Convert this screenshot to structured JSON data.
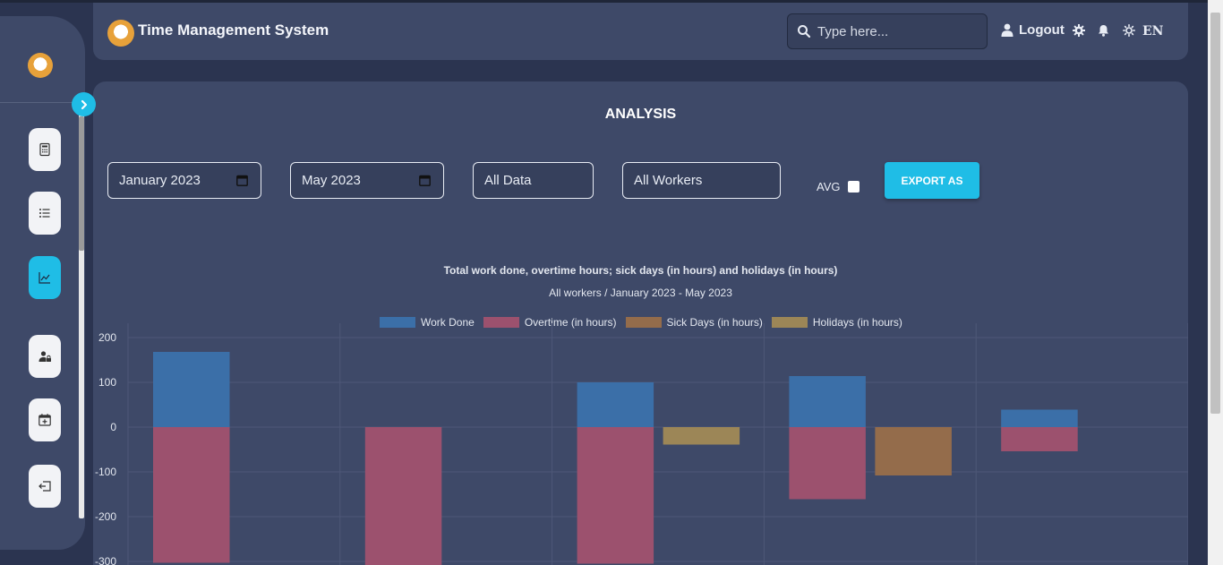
{
  "app": {
    "title": "Time Management System",
    "search_placeholder": "Type here...",
    "logout_label": "Logout",
    "language": "EN"
  },
  "sidebar": {
    "items": [
      {
        "icon": "calculator-icon",
        "active": false
      },
      {
        "icon": "list-icon",
        "active": false
      },
      {
        "icon": "chart-line-icon",
        "active": true
      },
      {
        "icon": "user-lock-icon",
        "active": false
      },
      {
        "icon": "calendar-plus-icon",
        "active": false
      },
      {
        "icon": "logout-icon",
        "active": false
      }
    ]
  },
  "colors": {
    "accent": "#1fbde6",
    "work_done": "#3b6fa8",
    "overtime": "#9c516e",
    "sick_days": "#946c4b",
    "holidays": "#9c8657"
  },
  "analysis": {
    "title": "ANALYSIS",
    "start_month": "January 2023",
    "end_month": "May 2023",
    "data_filter": "All Data",
    "worker_filter": "All Workers",
    "avg_label": "AVG",
    "avg_checked": false,
    "export_label": "EXPORT AS"
  },
  "chart_data": {
    "type": "bar",
    "title": "Total work done, overtime hours; sick days (in hours) and holidays (in hours)",
    "subtitle": "All workers / January 2023 - May 2023",
    "legend_position": "top",
    "grid": true,
    "series": [
      {
        "name": "Work Done",
        "values": [
          168,
          0,
          100,
          114,
          39
        ]
      },
      {
        "name": "Overtime (in hours)",
        "values": [
          -303,
          -318,
          -305,
          -161,
          -54
        ]
      },
      {
        "name": "Sick Days (in hours)",
        "values": [
          0,
          0,
          0,
          -108,
          0
        ]
      },
      {
        "name": "Holidays (in hours)",
        "values": [
          0,
          0,
          -39,
          0,
          0
        ]
      }
    ],
    "yticks": [
      200,
      100,
      0,
      -100,
      -200,
      -300
    ],
    "ylim": [
      -320,
      200
    ]
  }
}
